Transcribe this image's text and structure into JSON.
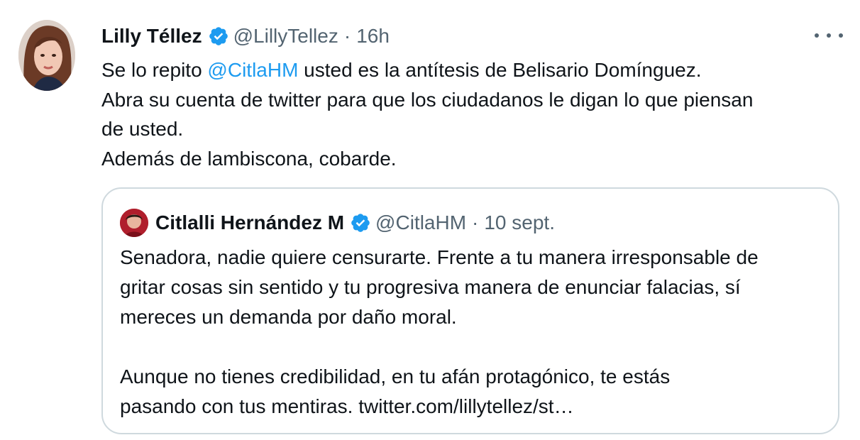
{
  "tweet": {
    "author_name": "Lilly Téllez",
    "author_handle": "@LillyTellez",
    "separator": "·",
    "time": "16h",
    "lines": [
      {
        "pre": "Se lo repito ",
        "mention": "@CitlaHM",
        "post": " usted es la antítesis de Belisario Domínguez."
      },
      {
        "text": "Abra su cuenta de twitter para que los ciudadanos le digan lo que piensan"
      },
      {
        "text": "de usted."
      },
      {
        "text": "Además de lambiscona, cobarde."
      }
    ],
    "more_icon": "more-horizontal-icon",
    "verified_icon": "verified-badge-icon"
  },
  "quote": {
    "author_name": "Citlalli Hernández M",
    "author_handle": "@CitlaHM",
    "separator": "·",
    "time": "10 sept.",
    "lines": [
      "Senadora, nadie quiere censurarte. Frente a tu manera irresponsable de",
      "gritar cosas sin sentido y tu progresiva manera de enunciar falacias, sí",
      "mereces un demanda por daño moral.",
      "",
      "Aunque no tienes credibilidad, en tu afán protagónico, te estás",
      "pasando con tus mentiras. twitter.com/lillytellez/st…"
    ]
  },
  "colors": {
    "text": "#0f1419",
    "muted": "#536471",
    "link": "#1d9bf0",
    "verified": "#1d9bf0",
    "border": "#cfd9de"
  }
}
